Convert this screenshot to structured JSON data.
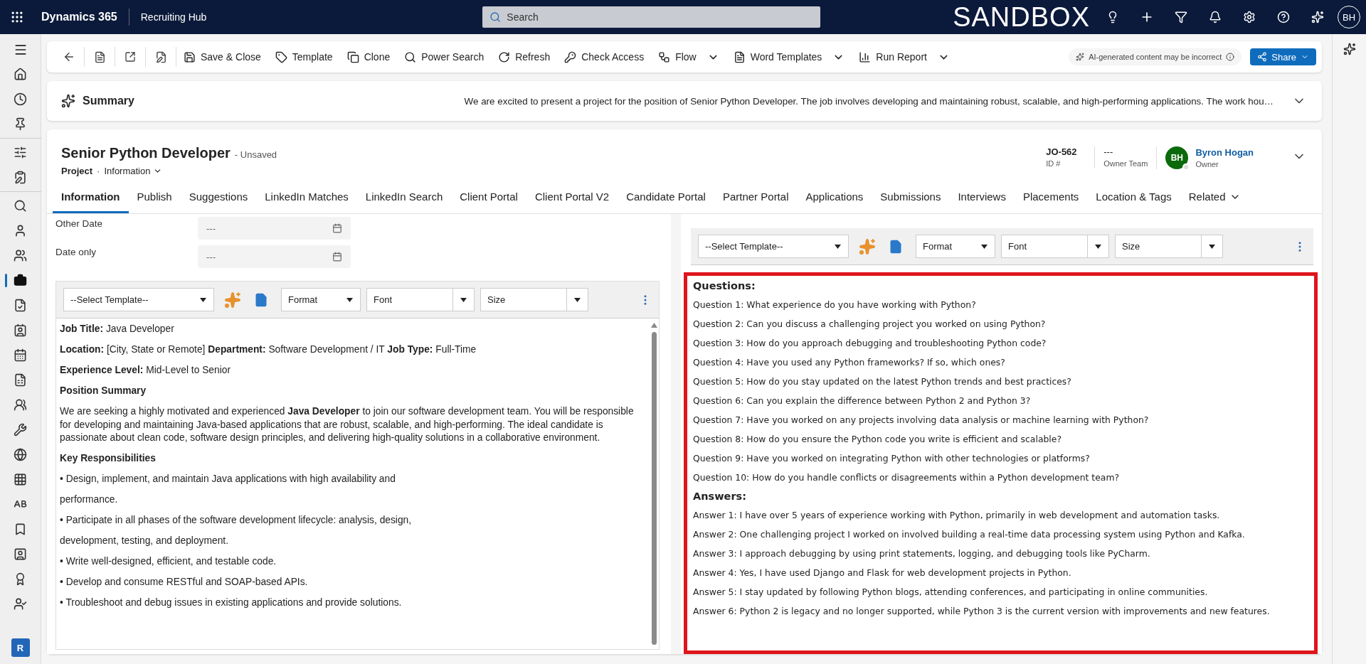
{
  "topbar": {
    "brand": "Dynamics 365",
    "area": "Recruiting Hub",
    "search": {
      "placeholder": "Search"
    },
    "environment": "SANDBOX",
    "avatar": "BH"
  },
  "sidebar": {
    "items": [
      {
        "selected": false
      },
      {
        "selected": false
      },
      {
        "selected": false
      },
      {
        "selected": false
      },
      {
        "selected": false
      },
      {
        "selected": false
      },
      {
        "selected": false
      },
      {
        "selected": false
      },
      {
        "selected": true
      },
      {
        "selected": false
      },
      {
        "selected": false
      },
      {
        "selected": false
      },
      {
        "selected": false
      },
      {
        "selected": false
      },
      {
        "selected": false
      },
      {
        "selected": false
      },
      {
        "selected": false
      },
      {
        "selected": false
      },
      {
        "selected": false
      },
      {
        "selected": false
      },
      {
        "selected": false
      },
      {
        "selected": false
      }
    ],
    "badge": "R"
  },
  "commands": [
    {
      "label": "Save & Close",
      "has_menu": false
    },
    {
      "label": "Template",
      "has_menu": false
    },
    {
      "label": "Clone",
      "has_menu": false
    },
    {
      "label": "Power Search",
      "has_menu": false
    },
    {
      "label": "Refresh",
      "has_menu": false
    },
    {
      "label": "Check Access",
      "has_menu": false
    },
    {
      "label": "Flow",
      "has_menu": true
    },
    {
      "label": "Word Templates",
      "has_menu": true
    },
    {
      "label": "Run Report",
      "has_menu": true
    }
  ],
  "ai_notice": "AI-generated content may be incorrect",
  "share": "Share",
  "summary": {
    "title": "Summary",
    "text": "We are excited to present a project for the position of Senior Python Developer. The job involves developing and maintaining robust, scalable, and high-performing applications. The work hou…"
  },
  "record": {
    "title": "Senior Python Developer",
    "status": "- Unsaved",
    "entity": "Project",
    "separator": "·",
    "form": "Information",
    "fields": [
      {
        "value": "JO-562",
        "label": "ID #"
      },
      {
        "value": "---",
        "label": "Owner Team"
      }
    ],
    "owner": {
      "initials": "BH",
      "name": "Byron Hogan",
      "label": "Owner"
    }
  },
  "tabs": [
    {
      "label": "Information",
      "selected": true
    },
    {
      "label": "Publish",
      "selected": false
    },
    {
      "label": "Suggestions",
      "selected": false
    },
    {
      "label": "LinkedIn Matches",
      "selected": false
    },
    {
      "label": "LinkedIn Search",
      "selected": false
    },
    {
      "label": "Client Portal",
      "selected": false
    },
    {
      "label": "Client Portal V2",
      "selected": false
    },
    {
      "label": "Candidate Portal",
      "selected": false
    },
    {
      "label": "Partner Portal",
      "selected": false
    },
    {
      "label": "Applications",
      "selected": false
    },
    {
      "label": "Submissions",
      "selected": false
    },
    {
      "label": "Interviews",
      "selected": false
    },
    {
      "label": "Placements",
      "selected": false
    },
    {
      "label": "Location & Tags",
      "selected": false
    },
    {
      "label": "Related",
      "selected": false
    }
  ],
  "left_form": {
    "fields": [
      {
        "label": "Other Date",
        "placeholder": "---"
      },
      {
        "label": "Date only",
        "placeholder": "---"
      }
    ]
  },
  "left_editor": {
    "toolbar": {
      "template": "--Select Template--",
      "format": "Format",
      "font": "Font",
      "size": "Size"
    },
    "blocks": [
      {
        "kind": "para",
        "text": "**Job Title:** Java Developer"
      },
      {
        "kind": "para",
        "text": "**Location:** [City, State or Remote] **Department:** Software Development / IT **Job Type:** Full-Time"
      },
      {
        "kind": "para",
        "text": "**Experience Level:** Mid-Level to Senior"
      },
      {
        "kind": "heading",
        "text": "Position Summary"
      },
      {
        "kind": "para",
        "text": "We are seeking a highly motivated and experienced **Java Developer** to join our software development team. You will be responsible for developing and maintaining Java-based applications that are robust, scalable, and high-performing. The ideal candidate is  passionate about clean code, software design principles, and delivering high-quality  solutions in a collaborative environment."
      },
      {
        "kind": "heading",
        "text": "Key Responsibilities"
      },
      {
        "kind": "para",
        "text": "•  Design, implement, and maintain Java applications with high availability and"
      },
      {
        "kind": "para",
        "text": "performance."
      },
      {
        "kind": "para",
        "text": "•  Participate in all phases of the software development lifecycle: analysis, design,"
      },
      {
        "kind": "para",
        "text": "development, testing, and deployment."
      },
      {
        "kind": "para",
        "text": "•  Write well-designed, efficient, and testable code."
      },
      {
        "kind": "para",
        "text": "•  Develop and consume RESTful and SOAP-based APIs."
      },
      {
        "kind": "para",
        "text": "•  Troubleshoot and debug issues in existing applications and provide solutions."
      }
    ]
  },
  "right_editor": {
    "toolbar": {
      "template": "--Select Template--",
      "format": "Format",
      "font": "Font",
      "size": "Size"
    },
    "highlighted": true,
    "blocks": [
      {
        "kind": "heading",
        "text": "Questions:"
      },
      {
        "kind": "line",
        "text": "Question 1: What experience do you have working with Python?"
      },
      {
        "kind": "line",
        "text": "Question 2: Can you discuss a challenging project you worked on using Python?"
      },
      {
        "kind": "line",
        "text": "Question 3: How do you approach debugging and troubleshooting Python code?"
      },
      {
        "kind": "line",
        "text": "Question 4: Have you used any Python frameworks? If so, which ones?"
      },
      {
        "kind": "line",
        "text": "Question 5: How do you stay updated on the latest Python trends and best practices?"
      },
      {
        "kind": "line",
        "text": "Question 6: Can you explain the difference between Python 2 and Python 3?"
      },
      {
        "kind": "line",
        "text": "Question 7: Have you worked on any projects involving data analysis or machine learning with Python?"
      },
      {
        "kind": "line",
        "text": "Question 8: How do you ensure the Python code you write is efficient and scalable?"
      },
      {
        "kind": "line",
        "text": "Question 9: Have you worked on integrating Python with other technologies or platforms?"
      },
      {
        "kind": "line",
        "text": "Question 10: How do you handle conflicts or disagreements within a Python development team?"
      },
      {
        "kind": "heading",
        "text": "Answers:"
      },
      {
        "kind": "line",
        "text": "Answer 1: I have over 5 years of experience working with Python, primarily in web development and automation tasks."
      },
      {
        "kind": "line",
        "text": "Answer 2: One challenging project I worked on involved building a real-time data processing system using Python and Kafka."
      },
      {
        "kind": "line",
        "text": "Answer 3: I approach debugging by using print statements, logging, and debugging tools like PyCharm."
      },
      {
        "kind": "line",
        "text": "Answer 4: Yes, I have used Django and Flask for web development projects in Python."
      },
      {
        "kind": "line",
        "text": "Answer 5: I stay updated by following Python blogs, attending conferences, and participating in online communities."
      },
      {
        "kind": "line",
        "text": "Answer 6: Python 2 is legacy and no longer supported, while Python 3 is the current version with improvements and new features."
      }
    ]
  }
}
